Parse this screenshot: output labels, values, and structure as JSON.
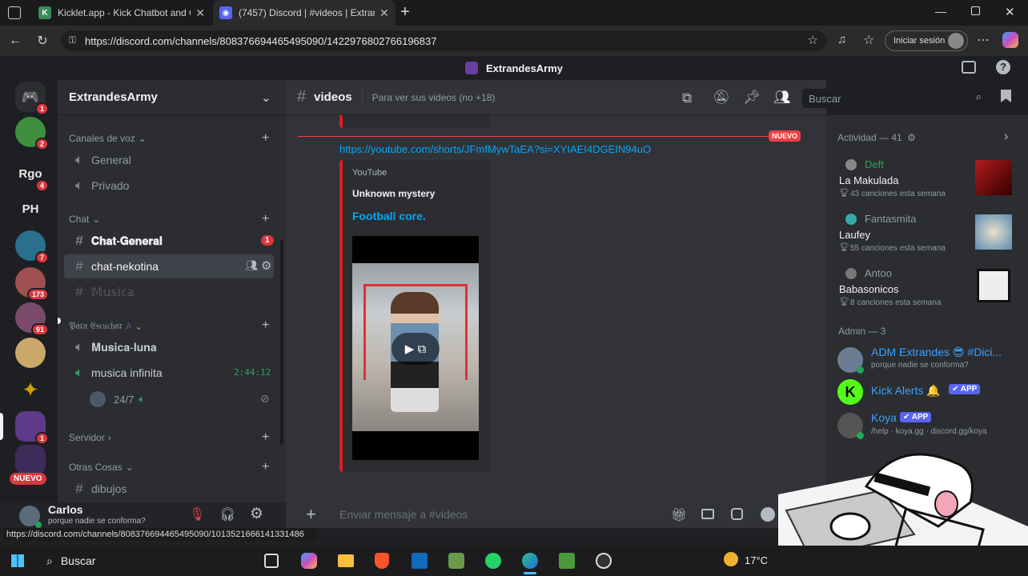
{
  "browser": {
    "tabs": [
      {
        "title": "Kicklet.app - Kick Chatbot and Ov",
        "active": false
      },
      {
        "title": "(7457) Discord | #videos | Extrand",
        "active": true
      }
    ],
    "url": "https://discord.com/channels/808376694465495090/1422976802766196837",
    "signin_label": "Iniciar sesión",
    "status_url": "https://discord.com/channels/808376694465495090/1013521666141331486"
  },
  "discord": {
    "top_title": "ExtrandesArmy",
    "servers": [
      {
        "label": "",
        "badge": "1",
        "color": "#5865f2"
      },
      {
        "label": "",
        "badge": "2",
        "color": "#3f8f3f"
      },
      {
        "label": "Rgo",
        "badge": "4",
        "color": "#2b2d31"
      },
      {
        "label": "PH",
        "badge": "",
        "color": "#2b2d31"
      },
      {
        "label": "",
        "badge": "7",
        "color": "#2a6f8c"
      },
      {
        "label": "",
        "badge": "173",
        "color": "#a05050"
      },
      {
        "label": "",
        "badge": "91",
        "color": "#7b4a6a"
      },
      {
        "label": "",
        "badge": "",
        "color": "#c9a86a"
      },
      {
        "label": "",
        "badge": "",
        "color": "#c8a200"
      },
      {
        "label": "",
        "badge": "1",
        "color": "#5d3b8a"
      },
      {
        "label": "",
        "badge": "",
        "color": "#3d2b5a"
      }
    ],
    "new_badge": "NUEVO",
    "server_name": "ExtrandesArmy",
    "categories": {
      "voice": "Canales de voz",
      "chat": "Chat",
      "listen": "𝔓𝔞𝔯𝔞 𝔈𝔰𝔠𝔲𝔠𝔥𝔞𝔯",
      "server": "Servidor",
      "other": "Otras Cosas"
    },
    "voice_channels": [
      "General",
      "Privado"
    ],
    "chat_channels": [
      {
        "name": "𝐂𝐡𝐚𝐭-𝐆𝐞𝐧𝐞𝐫𝐚𝐥",
        "badge": "1"
      },
      {
        "name": "chat-nekotina",
        "badge": ""
      },
      {
        "name": "𝕄𝕦𝕤𝕚𝕔𝕒",
        "badge": ""
      }
    ],
    "listen_channels": [
      {
        "name": "𝐌𝐮𝐬𝐢𝐜𝐚-𝐥𝐮𝐧𝐚",
        "time": ""
      },
      {
        "name": "musica infinita",
        "time": "2:44:12"
      }
    ],
    "voice_user": "24/7",
    "other_channel": "dibujos",
    "user": {
      "name": "Carlos",
      "status": "porque nadie se conforma?"
    },
    "channel": {
      "name": "videos",
      "topic": "Para ver sus videos (no +18)"
    },
    "search_placeholder": "Buscar",
    "new_marker": "NUEVO",
    "message": {
      "link": "https://youtube.com/shorts/JFmfMywTaEA?si=XYIAEI4DGEIN94uO",
      "embed_provider": "YouTube",
      "embed_author": "Unknown mystery",
      "embed_title": "Football core."
    },
    "composer_placeholder": "Enviar mensaje a #videos",
    "activity": {
      "header": "Actividad — 41",
      "items": [
        {
          "user": "Deft",
          "title": "La Makulada",
          "meta": "43 canciones esta semana",
          "user_color": "#23a55a"
        },
        {
          "user": "Fantasmita",
          "title": "Laufey",
          "meta": "55 canciones esta semana",
          "user_color": "#949ba4"
        },
        {
          "user": "Antoo",
          "title": "Babasonicos",
          "meta": "8 canciones esta semana",
          "user_color": "#949ba4"
        }
      ]
    },
    "admin": {
      "header": "Admin — 3",
      "members": [
        {
          "name": "ADM Extrandes 😎 #Dici...",
          "status": "porque nadie se conforma?",
          "tag": ""
        },
        {
          "name": "Kick Alerts 🔔",
          "status": "",
          "tag": "✔ APP"
        },
        {
          "name": "Koya",
          "status": "/help · koya.gg · discord.gg/koya",
          "tag": "✔ APP"
        }
      ]
    }
  },
  "taskbar": {
    "search": "Buscar",
    "temperature": "17°C"
  }
}
